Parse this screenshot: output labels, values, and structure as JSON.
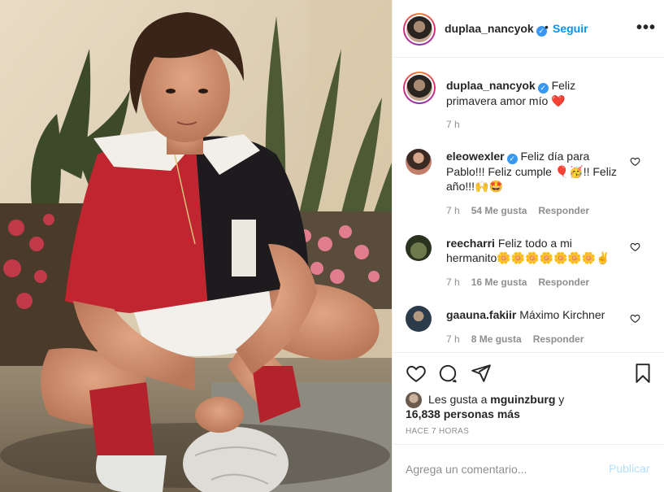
{
  "header": {
    "username": "duplaa_nancyok",
    "separator": "•",
    "follow_label": "Seguir",
    "more_icon": "more-horizontal-icon"
  },
  "caption": {
    "username": "duplaa_nancyok",
    "text": "Feliz primavera amor mío",
    "emoji": "❤️",
    "time": "7 h"
  },
  "comments": [
    {
      "username": "eleowexler",
      "verified": true,
      "text": "Feliz día para Pablo!!! Feliz cumple 🎈🥳!! Feliz año!!!🙌🤩",
      "time": "7 h",
      "likes": "54 Me gusta",
      "reply": "Responder"
    },
    {
      "username": "reecharri",
      "verified": false,
      "text": "Feliz todo a mi hermanito🌼🌼🌼🌼🌼🌼🌼✌️",
      "time": "7 h",
      "likes": "16 Me gusta",
      "reply": "Responder"
    },
    {
      "username": "gaauna.fakiir",
      "verified": false,
      "text": "Máximo Kirchner",
      "time": "7 h",
      "likes": "8 Me gusta",
      "reply": "Responder"
    }
  ],
  "likes": {
    "prefix": "Les gusta a",
    "user": "mguinzburg",
    "conj": "y",
    "others": "16,838 personas más"
  },
  "time_ago": "HACE 7 HORAS",
  "comment_box": {
    "placeholder": "Agrega un comentario...",
    "publish_label": "Publicar"
  },
  "colors": {
    "link": "#0095f6",
    "verified": "#3897f0",
    "muted": "#8e8e8e",
    "publish_disabled": "#b2dffc"
  }
}
